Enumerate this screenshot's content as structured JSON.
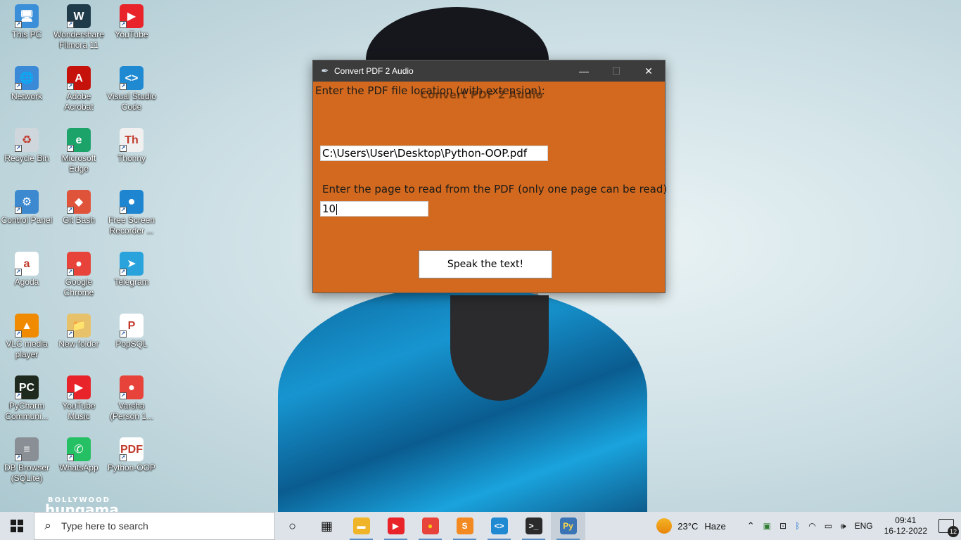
{
  "desktop": {
    "icons": [
      {
        "label": "This PC",
        "icon": "computer-icon",
        "color": "#3b8fd9",
        "glyph": "🖥"
      },
      {
        "label": "Wondershare Filmora 11",
        "icon": "filmora-icon",
        "color": "#1f3b4a",
        "glyph": "W"
      },
      {
        "label": "YouTube",
        "icon": "youtube-icon",
        "color": "#e8232a",
        "glyph": "▶"
      },
      {
        "label": "Network",
        "icon": "network-icon",
        "color": "#3a8ad8",
        "glyph": "🌐"
      },
      {
        "label": "Adobe Acrobat",
        "icon": "acrobat-icon",
        "color": "#c5120b",
        "glyph": "A"
      },
      {
        "label": "Visual Studio Code",
        "icon": "vscode-icon",
        "color": "#1f8ad2",
        "glyph": "<>"
      },
      {
        "label": "Recycle Bin",
        "icon": "recycle-bin-icon",
        "color": "#cfd6dc",
        "glyph": "♻"
      },
      {
        "label": "Microsoft Edge",
        "icon": "edge-icon",
        "color": "#1ba36a",
        "glyph": "e"
      },
      {
        "label": "Thonny",
        "icon": "thonny-icon",
        "color": "#f0f0f0",
        "glyph": "Th"
      },
      {
        "label": "Control Panel",
        "icon": "control-panel-icon",
        "color": "#3c89d0",
        "glyph": "⚙"
      },
      {
        "label": "Git Bash",
        "icon": "git-bash-icon",
        "color": "#e0533b",
        "glyph": "◆"
      },
      {
        "label": "Free Screen Recorder ...",
        "icon": "screen-recorder-icon",
        "color": "#1e86d1",
        "glyph": "⏺"
      },
      {
        "label": "Agoda",
        "icon": "agoda-icon",
        "color": "#ffffff",
        "glyph": "a"
      },
      {
        "label": "Google Chrome",
        "icon": "chrome-icon",
        "color": "#e7433a",
        "glyph": "●"
      },
      {
        "label": "Telegram",
        "icon": "telegram-icon",
        "color": "#2aa3dd",
        "glyph": "➤"
      },
      {
        "label": "VLC media player",
        "icon": "vlc-icon",
        "color": "#f08a00",
        "glyph": "▲"
      },
      {
        "label": "New folder",
        "icon": "folder-icon",
        "color": "#e8c26a",
        "glyph": "📁"
      },
      {
        "label": "PopSQL",
        "icon": "popsql-icon",
        "color": "#ffffff",
        "glyph": "P"
      },
      {
        "label": "PyCharm Communi...",
        "icon": "pycharm-icon",
        "color": "#1f2a1f",
        "glyph": "PC"
      },
      {
        "label": "YouTube Music",
        "icon": "youtube-music-icon",
        "color": "#e8232a",
        "glyph": "▶"
      },
      {
        "label": "Varsha (Person 1...",
        "icon": "chrome-profile-icon",
        "color": "#e7433a",
        "glyph": "●"
      },
      {
        "label": "DB Browser (SQLite)",
        "icon": "db-browser-icon",
        "color": "#8a8f96",
        "glyph": "≡"
      },
      {
        "label": "WhatsApp",
        "icon": "whatsapp-icon",
        "color": "#25c063",
        "glyph": "✆"
      },
      {
        "label": "Python-OOP",
        "icon": "pdf-file-icon",
        "color": "#ffffff",
        "glyph": "PDF"
      }
    ],
    "watermark_top": "BOLLYWOOD",
    "watermark_bottom": "hungama"
  },
  "window": {
    "title": "Convert PDF 2 Audio",
    "minimize": "—",
    "maximize": "☐",
    "close": "✕",
    "background": "#d2691e",
    "ghost_heading": "Convert PDF 2 Audio",
    "file_label": "Enter the PDF file location (with extension):",
    "file_value": "C:\\Users\\User\\Desktop\\Python-OOP.pdf",
    "page_label": "Enter the page to read from the PDF (only one page can be read)",
    "page_value": "10",
    "speak_button": "Speak the text!"
  },
  "taskbar": {
    "search_placeholder": "Type here to search",
    "apps": [
      {
        "name": "task-view",
        "glyph": "○",
        "color": "transparent",
        "text_color": "#111"
      },
      {
        "name": "widgets",
        "glyph": "▦",
        "color": "transparent",
        "text_color": "#111"
      },
      {
        "name": "file-explorer",
        "glyph": "▬",
        "color": "#f0b429",
        "text_color": "#fff"
      },
      {
        "name": "youtube-music",
        "glyph": "▶",
        "color": "#e8232a",
        "text_color": "#fff"
      },
      {
        "name": "chrome",
        "glyph": "●",
        "color": "#e7433a",
        "text_color": "#f6c915"
      },
      {
        "name": "sublime-text",
        "glyph": "S",
        "color": "#f28a21",
        "text_color": "#fff"
      },
      {
        "name": "vscode",
        "glyph": "<>",
        "color": "#1f8ad2",
        "text_color": "#fff"
      },
      {
        "name": "terminal",
        "glyph": ">_",
        "color": "#2b2b2b",
        "text_color": "#fff"
      },
      {
        "name": "python",
        "glyph": "Py",
        "color": "#3a74b5",
        "text_color": "#fbd84a"
      }
    ],
    "weather_temp": "23°C",
    "weather_desc": "Haze",
    "language": "ENG",
    "time": "09:41",
    "date": "16-12-2022",
    "notification_count": "12"
  }
}
